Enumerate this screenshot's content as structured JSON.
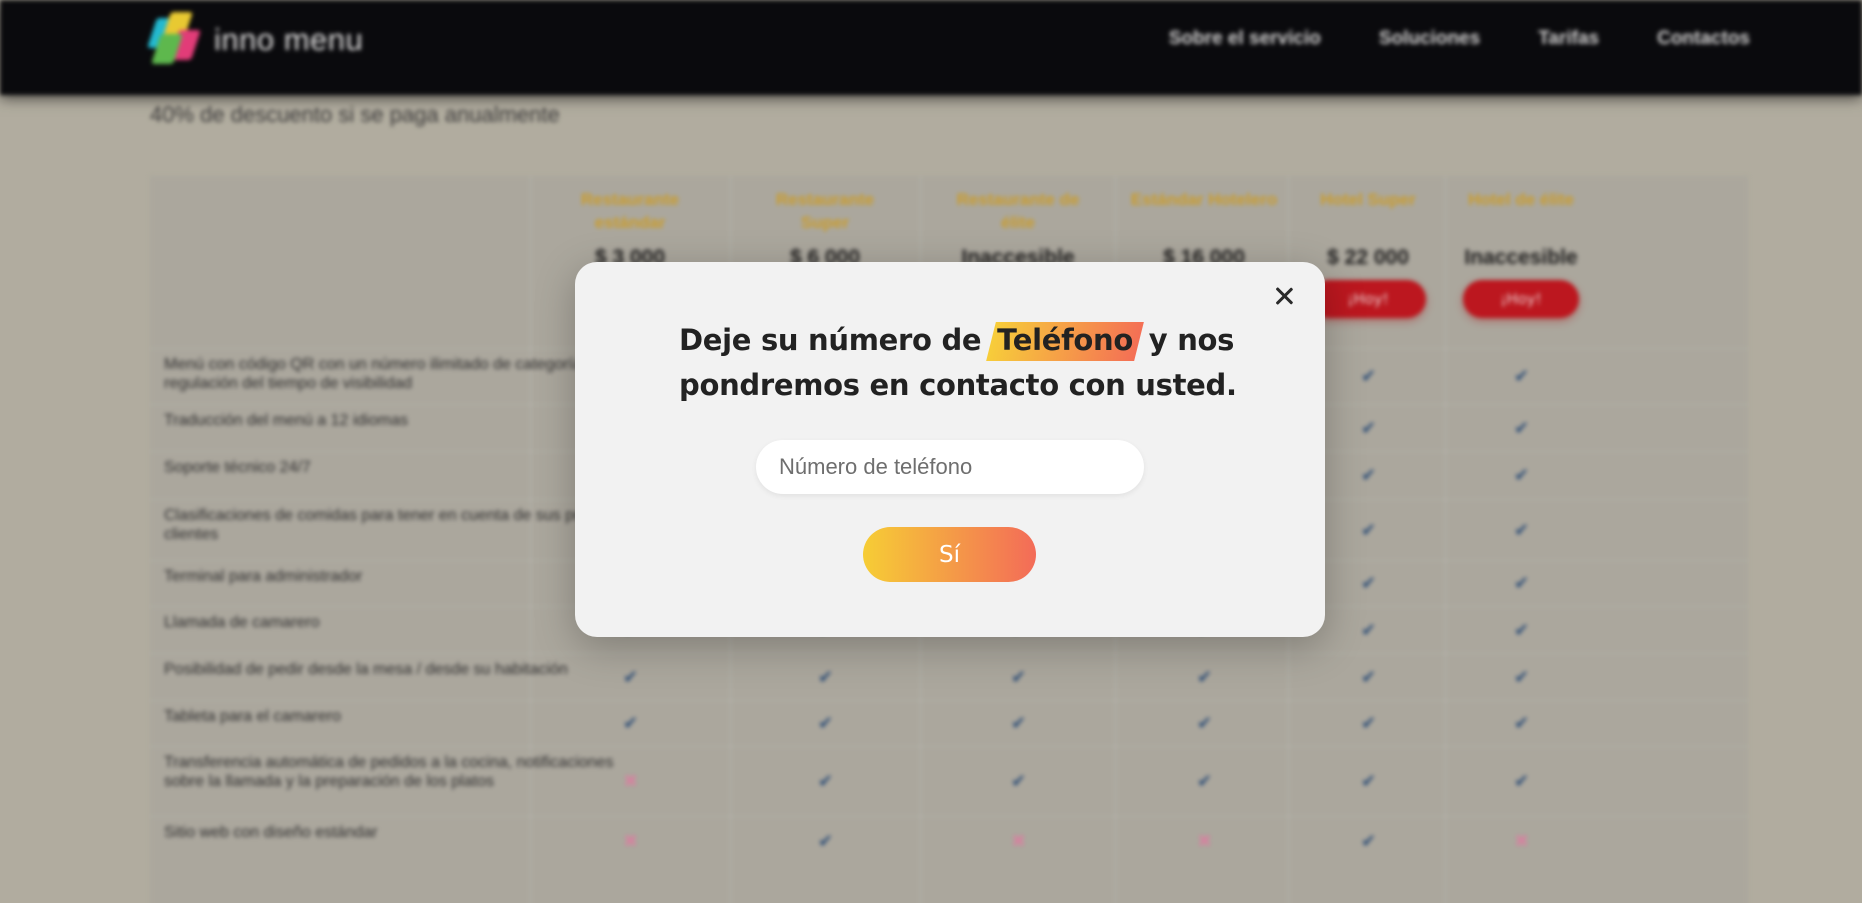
{
  "header": {
    "brand": "inno menu",
    "nav": [
      "Sobre el servicio",
      "Soluciones",
      "Tarifas",
      "Contactos"
    ]
  },
  "pricing": {
    "discount_note": "40% de descuento si se paga anualmente",
    "plans": [
      {
        "name": "Restaurante estándar",
        "price": "$ 3 000",
        "cta": ""
      },
      {
        "name": "Restaurante Super",
        "price": "$ 6 000",
        "cta": ""
      },
      {
        "name": "Restaurante de élite",
        "price": "Inaccesible",
        "cta": ""
      },
      {
        "name": "Estándar Hotelero",
        "price": "$ 16 000",
        "cta": "¡Hoy!"
      },
      {
        "name": "Hotel Super",
        "price": "$ 22 000",
        "cta": "¡Hoy!"
      },
      {
        "name": "Hotel de élite",
        "price": "Inaccesible",
        "cta": "¡Hoy!"
      }
    ],
    "features": [
      {
        "label": "Menú con código QR con un número ilimitado de categorías y regulación del tiempo de visibilidad",
        "marks": [
          "",
          "",
          "",
          "check",
          "check",
          "check"
        ]
      },
      {
        "label": "Traducción del menú a 12 idiomas",
        "marks": [
          "",
          "",
          "",
          "check",
          "check",
          "check"
        ]
      },
      {
        "label": "Soporte técnico 24/7",
        "marks": [
          "",
          "",
          "",
          "check",
          "check",
          "check"
        ]
      },
      {
        "label": "Clasificaciones de comidas para tener en cuenta de sus propios clientes",
        "marks": [
          "",
          "",
          "",
          "check",
          "check",
          "check"
        ]
      },
      {
        "label": "Terminal para administrador",
        "marks": [
          "",
          "",
          "",
          "check",
          "check",
          "check"
        ]
      },
      {
        "label": "Llamada de camarero",
        "marks": [
          "check",
          "check",
          "check",
          "check",
          "check",
          "check"
        ]
      },
      {
        "label": "Posibilidad de pedir desde la mesa / desde su habitación",
        "marks": [
          "check",
          "check",
          "check",
          "check",
          "check",
          "check"
        ]
      },
      {
        "label": "Tableta para el camarero",
        "marks": [
          "check",
          "check",
          "check",
          "check",
          "check",
          "check"
        ]
      },
      {
        "label": "Transferencia automática de pedidos a la cocina, notificaciones sobre la llamada y la preparación de los platos",
        "marks": [
          "cross",
          "check",
          "check",
          "check",
          "check",
          "check"
        ]
      },
      {
        "label": "Sitio web con diseño estándar",
        "marks": [
          "cross",
          "check",
          "cross",
          "cross",
          "check",
          "cross"
        ]
      }
    ]
  },
  "modal": {
    "title_before": "Deje su número de",
    "title_highlight": "Teléfono",
    "title_after": "y nos pondremos en contacto con usted.",
    "phone_placeholder": "Número de teléfono",
    "submit_label": "Sí"
  },
  "icons": {
    "close": "close-icon",
    "check": "check-icon",
    "cross": "cross-icon"
  },
  "colors": {
    "header_bg": "#07080b",
    "plan_name": "#d1a22a",
    "plan_button": "#c2161e",
    "highlight_start": "#f7cd3a",
    "highlight_end": "#f46f55",
    "submit_start": "#f6cd35",
    "submit_end": "#f36b58"
  }
}
